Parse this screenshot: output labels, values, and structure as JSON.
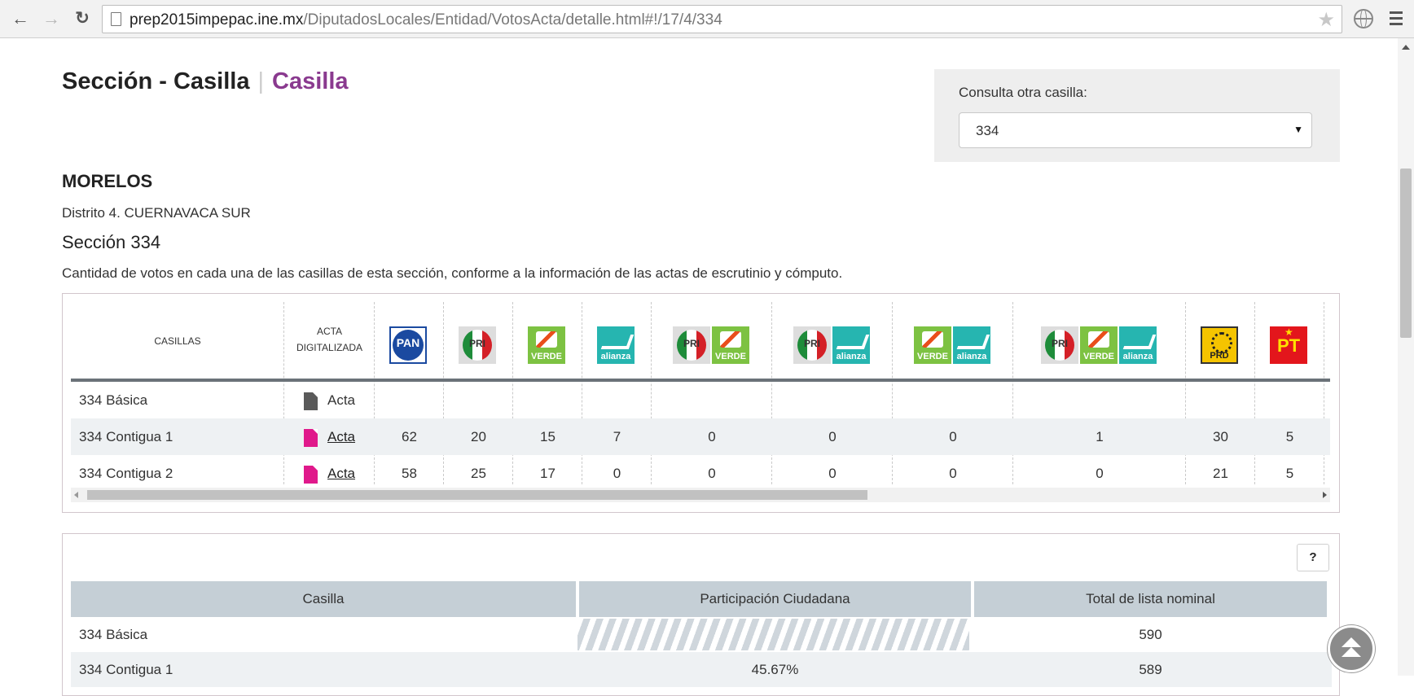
{
  "browser": {
    "url_host": "prep2015impepac.ine.mx",
    "url_path": "/DiputadosLocales/Entidad/VotosActa/detalle.html#!/17/4/334"
  },
  "header": {
    "title": "Sección - Casilla",
    "subtitle": "Casilla"
  },
  "consulta": {
    "label": "Consulta otra casilla:",
    "selected": "334"
  },
  "location": {
    "estado": "MORELOS",
    "distrito": "Distrito 4. CUERNAVACA SUR",
    "seccion": "Sección 334",
    "descripcion": "Cantidad de votos en cada una de las casillas de esta sección, conforme a la información de las actas de escrutinio y cómputo."
  },
  "votes_table": {
    "col_casillas": "CASILLAS",
    "col_acta_1": "ACTA",
    "col_acta_2": "DIGITALIZADA",
    "logos": {
      "pan": "PAN",
      "pri": "PRI",
      "verde": "VERDE",
      "alianza": "alianza",
      "prd": "PRD",
      "pt": "PT"
    },
    "rows": [
      {
        "casilla": "334 Básica",
        "acta": "Acta",
        "values": [
          "",
          "",
          "",
          "",
          "",
          "",
          "",
          "",
          "",
          ""
        ]
      },
      {
        "casilla": "334 Contigua 1",
        "acta": "Acta",
        "values": [
          "62",
          "20",
          "15",
          "7",
          "0",
          "0",
          "0",
          "1",
          "30",
          "5"
        ]
      },
      {
        "casilla": "334 Contigua 2",
        "acta": "Acta",
        "values": [
          "58",
          "25",
          "17",
          "0",
          "0",
          "0",
          "0",
          "0",
          "21",
          "5"
        ]
      }
    ]
  },
  "participation": {
    "help_label": "?",
    "col_casilla": "Casilla",
    "col_participacion": "Participación Ciudadana",
    "col_total": "Total de lista nominal",
    "rows": [
      {
        "casilla": "334 Básica",
        "participacion": "",
        "total": "590"
      },
      {
        "casilla": "334 Contigua 1",
        "participacion": "45.67%",
        "total": "589"
      }
    ]
  },
  "colors": {
    "accent_purple": "#8a3a8f",
    "acta_pink": "#e0198b",
    "table_header": "#c5cfd6"
  }
}
